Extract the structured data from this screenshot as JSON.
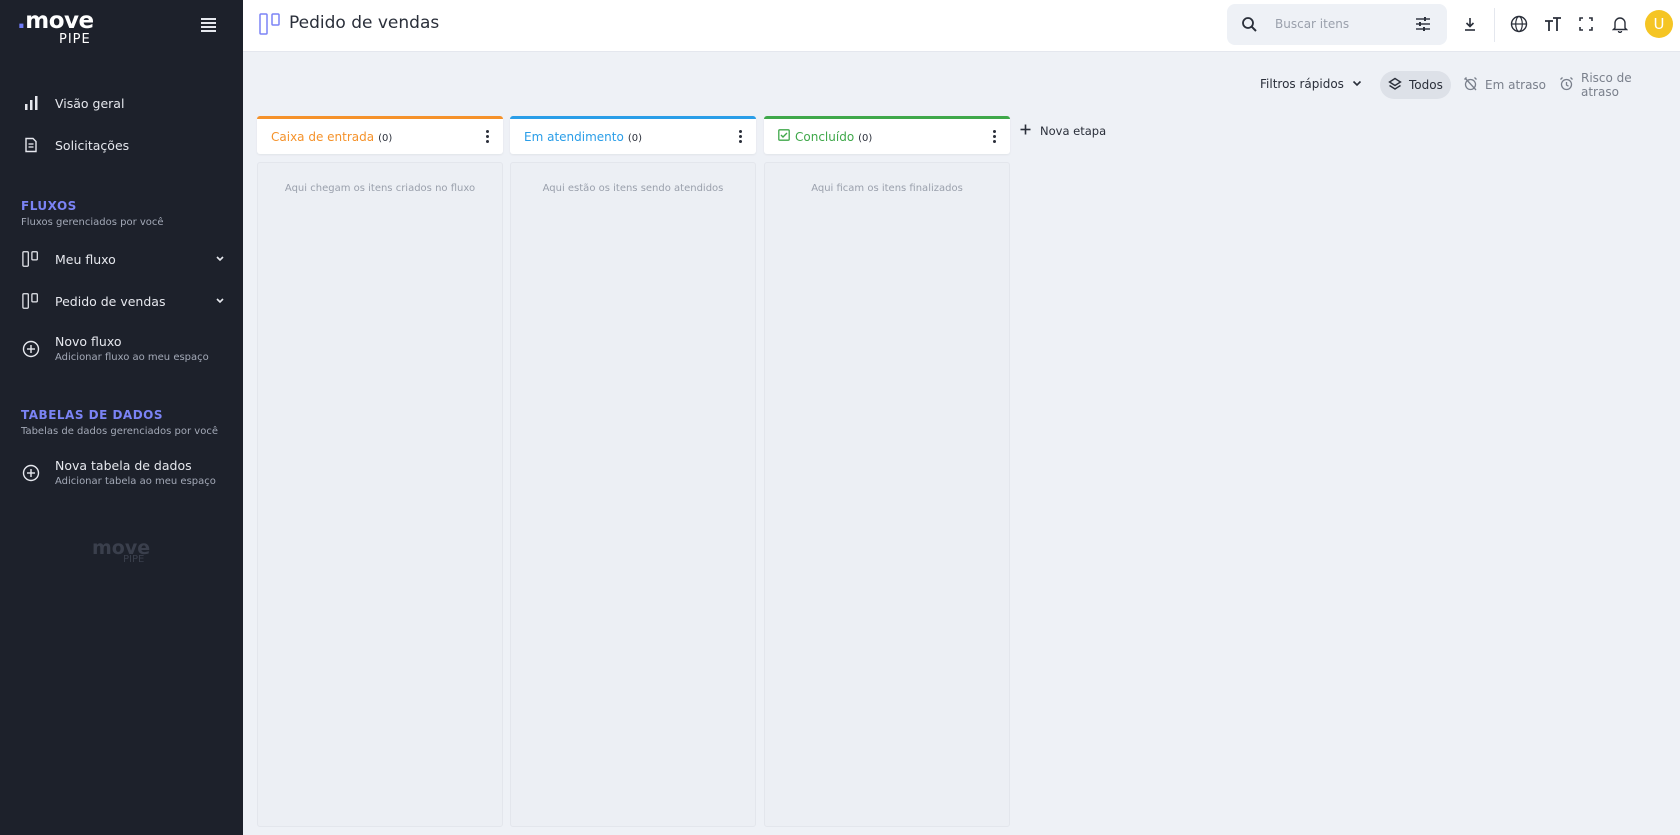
{
  "sidebar": {
    "logo_move": "move",
    "logo_pipe": "PIPE",
    "nav": [
      {
        "label": "Visão geral"
      },
      {
        "label": "Solicitações"
      }
    ],
    "flows_section": {
      "title": "FLUXOS",
      "subtitle": "Fluxos gerenciados por você"
    },
    "flows": [
      {
        "label": "Meu fluxo"
      },
      {
        "label": "Pedido de vendas"
      }
    ],
    "new_flow": {
      "label": "Novo fluxo",
      "sub": "Adicionar fluxo ao meu espaço"
    },
    "tables_section": {
      "title": "TABELAS DE DADOS",
      "subtitle": "Tabelas de dados gerenciados por você"
    },
    "new_table": {
      "label": "Nova tabela de dados",
      "sub": "Adicionar tabela ao meu espaço"
    },
    "watermark_move": "move",
    "watermark_pipe": "PIPE"
  },
  "header": {
    "title": "Pedido de vendas",
    "search_placeholder": "Buscar itens",
    "avatar_initial": "U"
  },
  "filters": {
    "quick_label": "Filtros rápidos",
    "chips": [
      {
        "label": "Todos",
        "active": true
      },
      {
        "label": "Em atraso",
        "active": false
      },
      {
        "label": "Risco de atraso",
        "active": false
      }
    ]
  },
  "board": {
    "columns": [
      {
        "title": "Caixa de entrada",
        "count": "(0)",
        "color": "#f5922a",
        "empty_text": "Aqui chegam os itens criados no fluxo"
      },
      {
        "title": "Em atendimento",
        "count": "(0)",
        "color": "#2a9ee8",
        "empty_text": "Aqui estão os itens sendo atendidos"
      },
      {
        "title": "Concluído",
        "count": "(0)",
        "color": "#3fa84a",
        "empty_text": "Aqui ficam os itens finalizados"
      }
    ],
    "new_stage_label": "Nova etapa"
  },
  "colors": {
    "sidebar_bg": "#1d212b",
    "accent": "#7b83f5",
    "avatar": "#f5c524"
  }
}
